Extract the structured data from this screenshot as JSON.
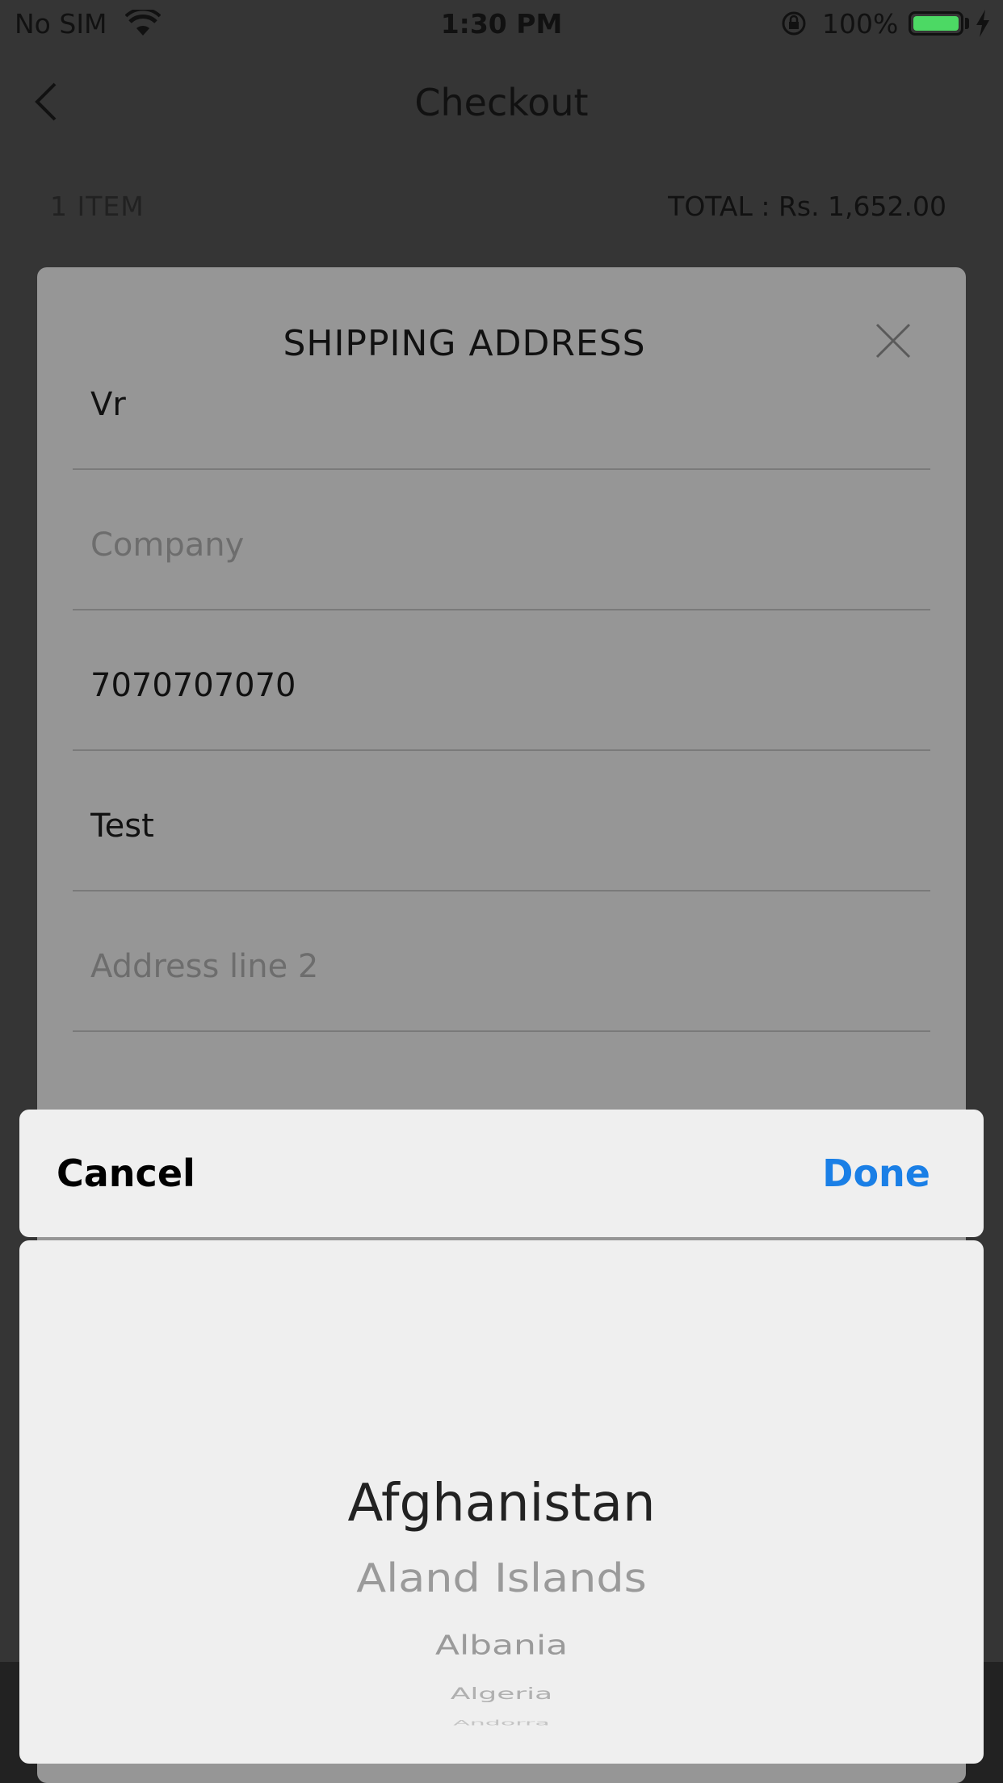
{
  "status_bar": {
    "carrier": "No SIM",
    "time": "1:30 PM",
    "battery": "100%",
    "battery_color": "#4cd964"
  },
  "nav": {
    "title": "Checkout",
    "back_icon": "chevron-left-icon"
  },
  "summary": {
    "item_count": "1 ITEM",
    "total": "TOTAL : Rs. 1,652.00"
  },
  "modal": {
    "title": "SHIPPING ADDRESS",
    "close_icon": "close-icon",
    "fields": {
      "name": {
        "value": "Vr",
        "placeholder": ""
      },
      "company": {
        "value": "",
        "placeholder": "Company"
      },
      "phone": {
        "value": "7070707070",
        "placeholder": ""
      },
      "address1": {
        "value": "Test",
        "placeholder": ""
      },
      "address2": {
        "value": "",
        "placeholder": "Address line 2"
      }
    }
  },
  "picker": {
    "cancel_label": "Cancel",
    "done_label": "Done",
    "accent_color": "#1a7fe6",
    "options": [
      "Afghanistan",
      "Aland Islands",
      "Albania",
      "Algeria",
      "Andorra"
    ]
  }
}
